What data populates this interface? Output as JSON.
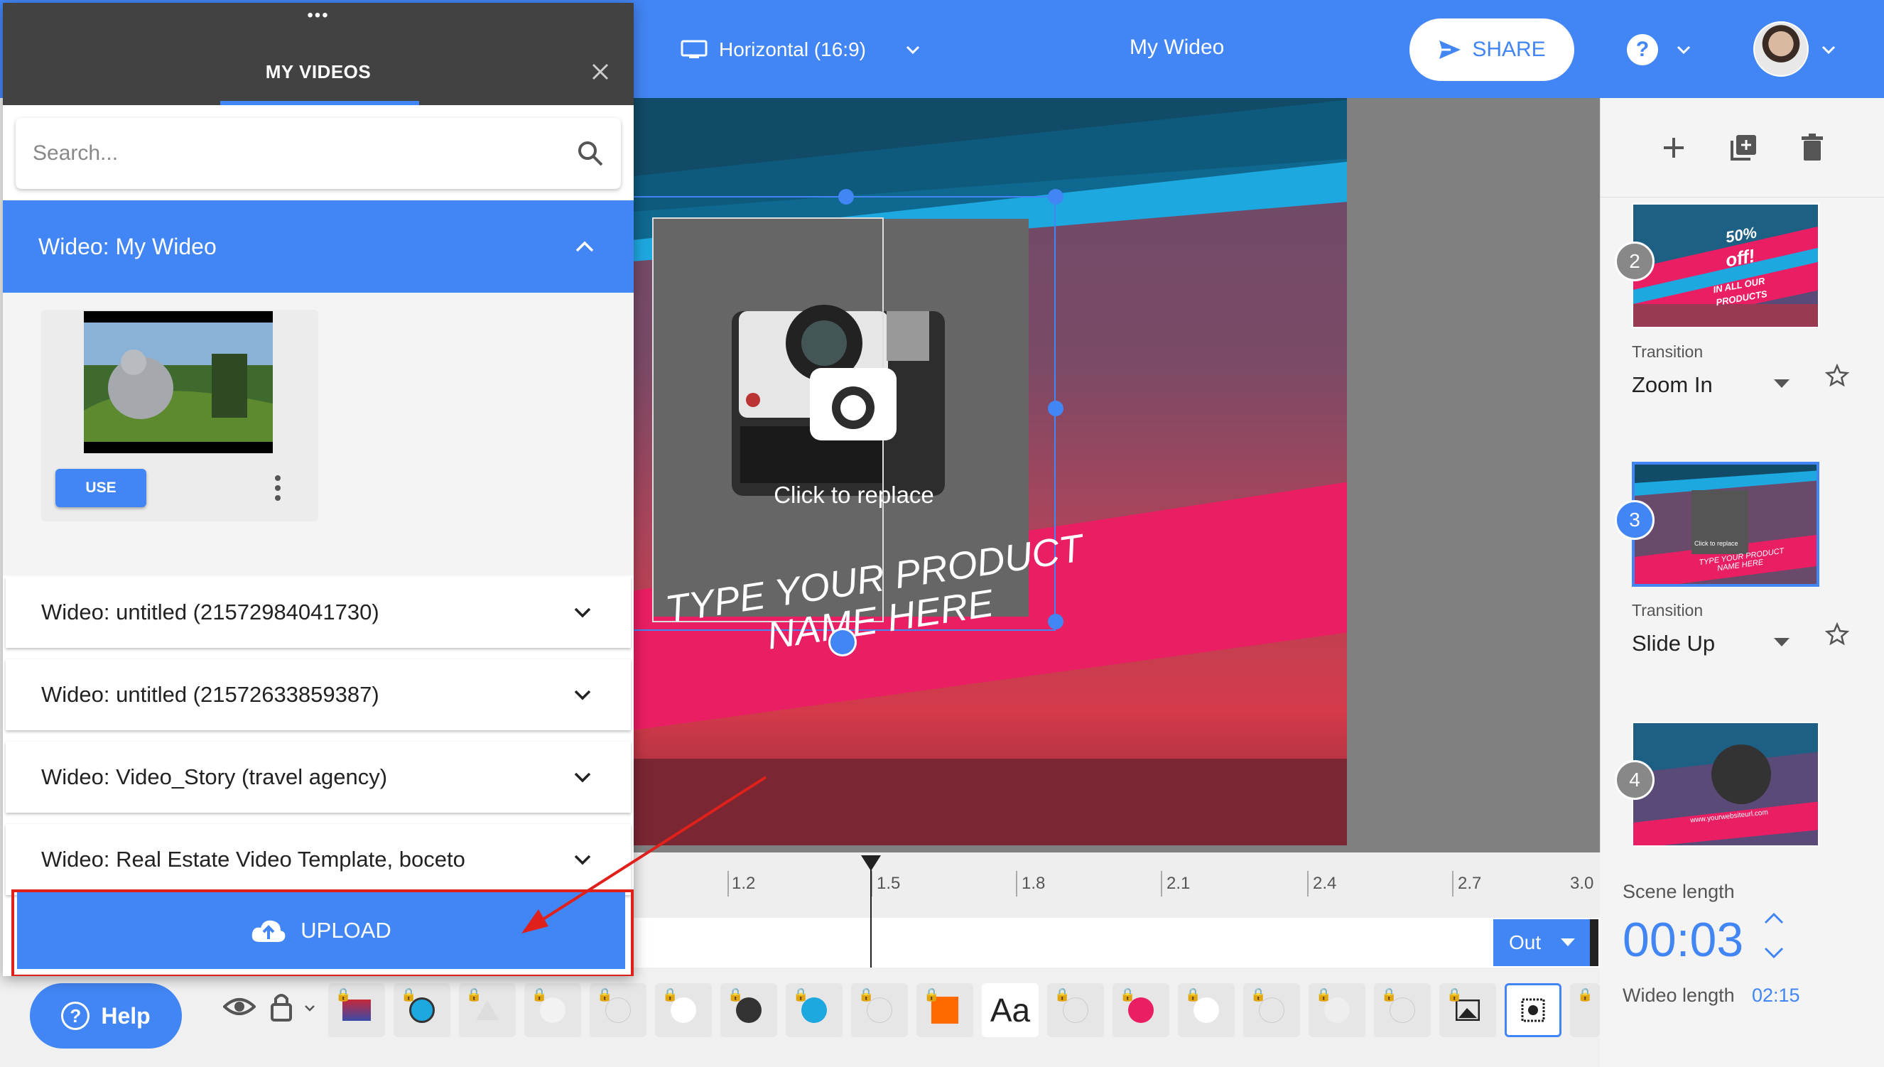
{
  "header": {
    "orientation_label": "Horizontal (16:9)",
    "project_title": "My Wideo",
    "share_label": "SHARE"
  },
  "my_videos_panel": {
    "drag_handle": "•••",
    "title": "MY VIDEOS",
    "search_placeholder": "Search...",
    "open_group": {
      "label": "Wideo: My Wideo",
      "use_label": "USE"
    },
    "groups": [
      {
        "label": "Wideo: untitled (21572984041730)"
      },
      {
        "label": "Wideo: untitled (21572633859387)"
      },
      {
        "label": "Wideo: Video_Story (travel agency)"
      },
      {
        "label": "Wideo: Real Estate Video Template, boceto"
      }
    ],
    "upload_label": "UPLOAD"
  },
  "canvas": {
    "replace_label": "Click to replace",
    "headline_line1": "TYPE YOUR PRODUCT",
    "headline_line2": "NAME HERE"
  },
  "scenes": {
    "items": [
      {
        "number": "2",
        "thumb_line1": "50%",
        "thumb_line2": "off!",
        "thumb_line3": "IN ALL OUR",
        "thumb_line4": "PRODUCTS",
        "transition_label": "Transition",
        "transition_value": "Zoom In"
      },
      {
        "number": "3",
        "thumb_line1": "TYPE YOUR PRODUCT",
        "thumb_line2": "NAME HERE",
        "thumb_line3": "Click to replace",
        "transition_label": "Transition",
        "transition_value": "Slide Up"
      },
      {
        "number": "4",
        "thumb_line1": "www.yourwebsiteurl.com"
      }
    ]
  },
  "timeline": {
    "ticks": [
      "1.2",
      "1.5",
      "1.8",
      "2.1",
      "2.4",
      "2.7",
      "3.0"
    ],
    "out_label": "Out"
  },
  "scene_info": {
    "scene_length_label": "Scene length",
    "scene_length_value": "00:03",
    "wideo_length_label": "Wideo length",
    "wideo_length_value": "02:15"
  },
  "toolbar": {
    "text_tile_label": "Aa",
    "help_label": "Help"
  },
  "colors": {
    "accent": "#4285f4",
    "dark_header": "#424242",
    "pink_banner": "#e91e63",
    "cyan_stripe": "#1ea8e0",
    "annotation_red": "#e0201a"
  }
}
